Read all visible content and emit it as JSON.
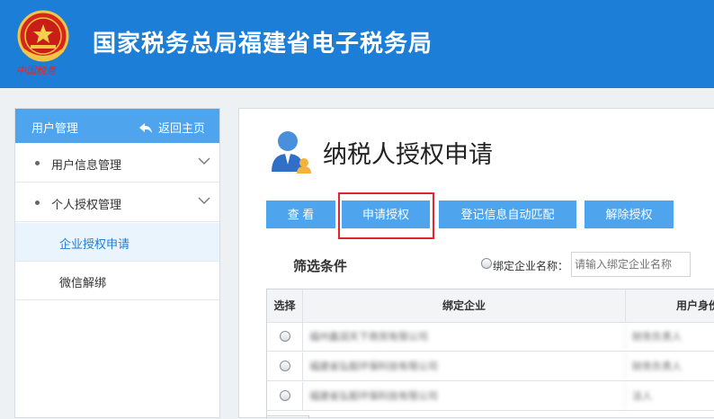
{
  "header": {
    "site_title": "国家税务总局福建省电子税务局",
    "emblem_text": "中国税务",
    "background": "#1c7ed6"
  },
  "sidebar": {
    "title": "用户管理",
    "back_label": "返回主页",
    "items": [
      {
        "label": "用户信息管理",
        "icon": "chevron-down-icon"
      },
      {
        "label": "个人授权管理",
        "icon": "chevron-down-icon"
      },
      {
        "label": "企业授权申请",
        "active": true
      },
      {
        "label": "微信解绑"
      }
    ]
  },
  "main": {
    "page_title": "纳税人授权申请",
    "toolbar": {
      "view_label": "查 看",
      "apply_label": "申请授权",
      "match_label": "登记信息自动匹配",
      "unbind_label": "解除授权"
    },
    "filter": {
      "title": "筛选条件",
      "radio_label": "绑定企业名称：",
      "input_placeholder": "请输入绑定企业名称"
    },
    "table": {
      "headers": [
        "选择",
        "绑定企业",
        "用户身份"
      ],
      "rows": [
        {
          "company": "福州鑫润天下商贸有限公司",
          "identity": "财务负责人"
        },
        {
          "company": "福建省弘毅环保科技有限公司",
          "identity": "财务负责人"
        },
        {
          "company": "福建省弘毅环保科技有限公司",
          "identity": "法人"
        }
      ]
    }
  },
  "colors": {
    "accent": "#4ea5ee",
    "highlight_border": "#e3262b"
  }
}
